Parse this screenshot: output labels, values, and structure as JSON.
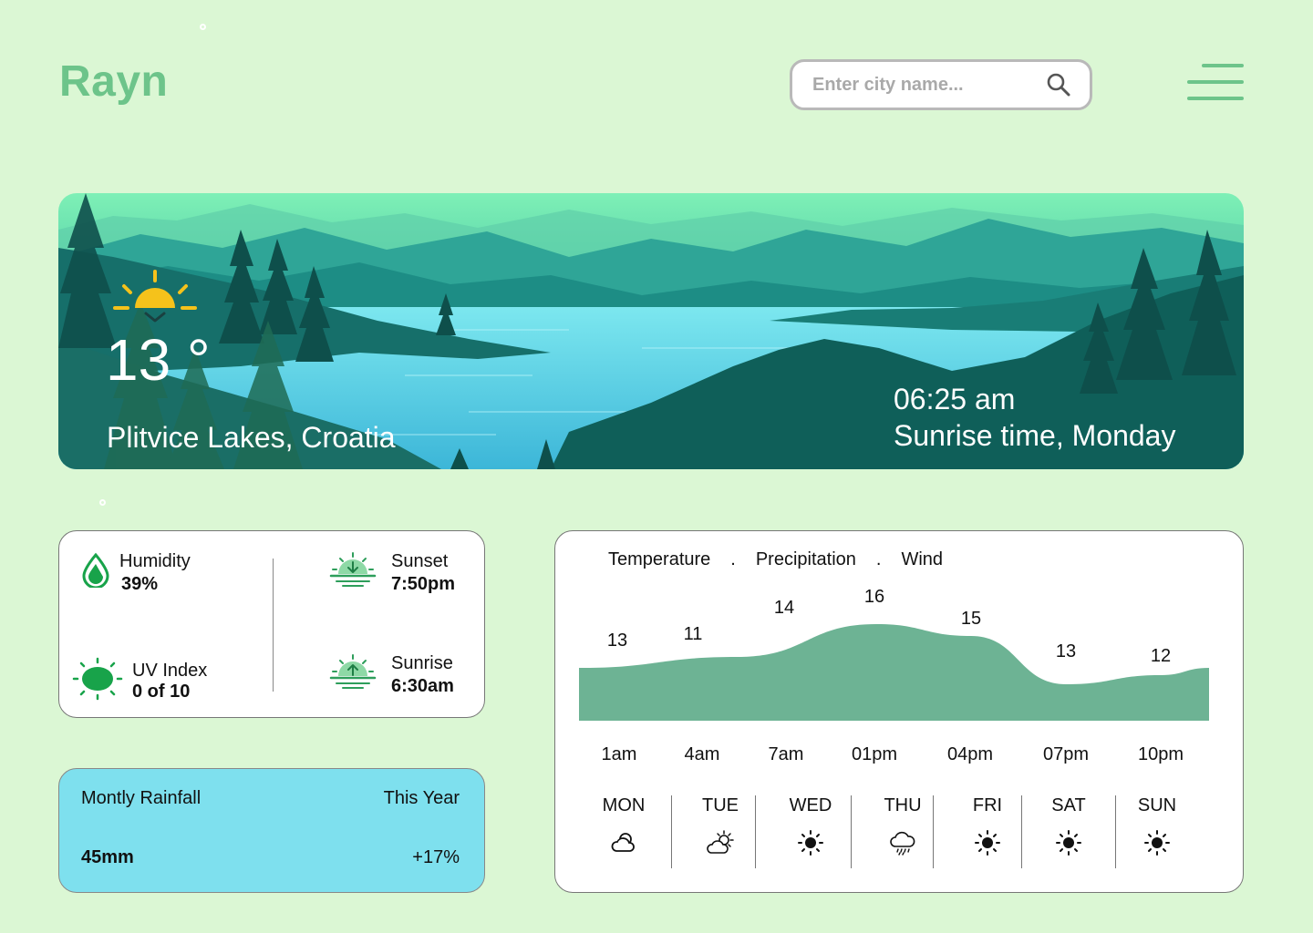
{
  "app": {
    "title": "Rayn",
    "accent": "#6dc48a",
    "background": "#dbf7d4"
  },
  "search": {
    "placeholder": "Enter city name...",
    "icon": "search-icon"
  },
  "menu": {
    "icon": "hamburger-menu-icon"
  },
  "hero": {
    "temperature": "13 °",
    "location": "Plitvice Lakes, Croatia",
    "time": "06:25 am",
    "time_label": "Sunrise time, Monday",
    "icon": "sunrise-icon"
  },
  "stats": {
    "humidity": {
      "label": "Humidity",
      "value": "39%",
      "icon": "water-drop-icon"
    },
    "sunset": {
      "label": "Sunset",
      "value": "7:50pm",
      "icon": "sunset-icon"
    },
    "uv": {
      "label": "UV Index",
      "value": "0 of 10",
      "icon": "sun-icon"
    },
    "sunrise": {
      "label": "Sunrise",
      "value": "6:30am",
      "icon": "sunrise-icon"
    }
  },
  "rainfall": {
    "title": "Montly Rainfall",
    "period": "This Year",
    "amount": "45mm",
    "change": "+17%",
    "color": "#7ee0ee"
  },
  "forecast": {
    "tabs": [
      "Temperature",
      "Precipitation",
      "Wind"
    ],
    "tab_separator": ".",
    "days": [
      {
        "label": "MON",
        "icon": "partly-cloudy-icon"
      },
      {
        "label": "TUE",
        "icon": "sun-behind-cloud-icon"
      },
      {
        "label": "WED",
        "icon": "sun-icon"
      },
      {
        "label": "THU",
        "icon": "rain-cloud-icon"
      },
      {
        "label": "FRI",
        "icon": "sun-icon"
      },
      {
        "label": "SAT",
        "icon": "sun-icon"
      },
      {
        "label": "SUN",
        "icon": "sun-icon"
      }
    ]
  },
  "chart_data": {
    "type": "area",
    "categories": [
      "1am",
      "4am",
      "7am",
      "01pm",
      "04pm",
      "07pm",
      "10pm"
    ],
    "values": [
      13,
      11,
      14,
      16,
      15,
      13,
      12
    ],
    "fill": "#6db394",
    "grid": false,
    "legend": "none"
  }
}
